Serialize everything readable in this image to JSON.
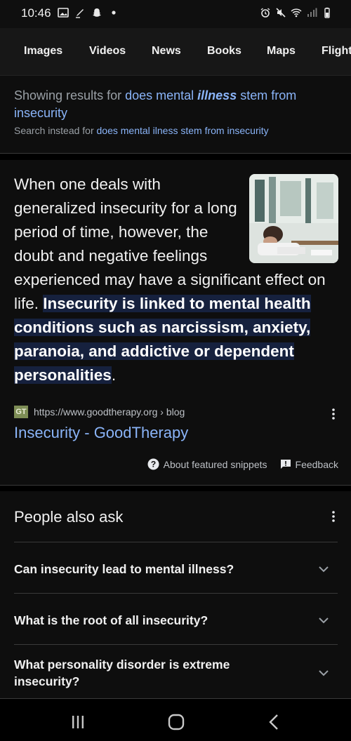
{
  "status_bar": {
    "time": "10:46"
  },
  "tabs": [
    "Images",
    "Videos",
    "News",
    "Books",
    "Maps",
    "Flights"
  ],
  "spelling": {
    "showing_prefix": "Showing results for",
    "corrected_pre": "does mental",
    "corrected_em": "illness",
    "corrected_post": "stem from insecurity",
    "instead_prefix": "Search instead for",
    "original_query": "does mental ilness stem from insecurity"
  },
  "snippet": {
    "text_plain": "When one deals with generalized insecurity for a long period of time, however, the doubt and negative feelings experienced may have a significant effect on life. ",
    "text_highlight": "Insecurity is linked to mental health conditions such as narcissism, anxiety, paranoia, and addictive or dependent personalities",
    "text_end": ".",
    "favicon_text": "GT",
    "source_url": "https://www.goodtherapy.org › blog",
    "source_title": "Insecurity - GoodTherapy",
    "about_label": "About featured snippets",
    "feedback_label": "Feedback"
  },
  "people_also_ask": {
    "title": "People also ask",
    "questions": [
      "Can insecurity lead to mental illness?",
      "What is the root of all insecurity?",
      "What personality disorder is extreme insecurity?"
    ]
  },
  "icons": {
    "status_left": [
      "gallery-icon",
      "pen-icon",
      "snapchat-icon",
      "dot-icon"
    ],
    "status_right": [
      "alarm-icon",
      "mute-icon",
      "wifi-icon",
      "signal-icon",
      "battery-icon"
    ],
    "nav": [
      "recents-icon",
      "home-icon",
      "back-icon"
    ]
  },
  "colors": {
    "link": "#8ab4f8",
    "highlight_bg": "#16213e",
    "favicon_bg": "#7d8d55"
  }
}
